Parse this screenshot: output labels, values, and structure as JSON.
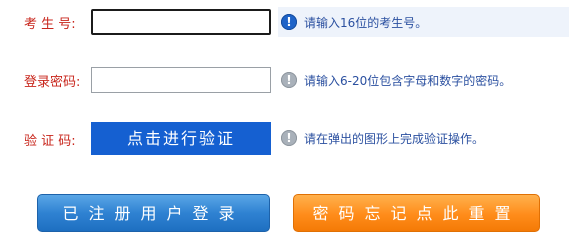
{
  "form": {
    "exam_number": {
      "label": "考 生 号:",
      "value": "",
      "hint": "请输入16位的考生号。"
    },
    "password": {
      "label": "登录密码:",
      "value": "",
      "hint": "请输入6-20位包含字母和数字的密码。"
    },
    "verification": {
      "label": "验 证 码:",
      "button_label": "点击进行验证",
      "hint": "请在弹出的图形上完成验证操作。"
    }
  },
  "buttons": {
    "login_label": "已注册用户登录",
    "reset_label": "密码忘记点此重置"
  },
  "colors": {
    "label_red": "#c8261c",
    "hint_blue": "#2b50a0",
    "verify_blue": "#1560d1",
    "login_blue": "#2f82d2",
    "reset_orange": "#ff8c1a"
  },
  "icons": {
    "hint": "info-icon"
  }
}
